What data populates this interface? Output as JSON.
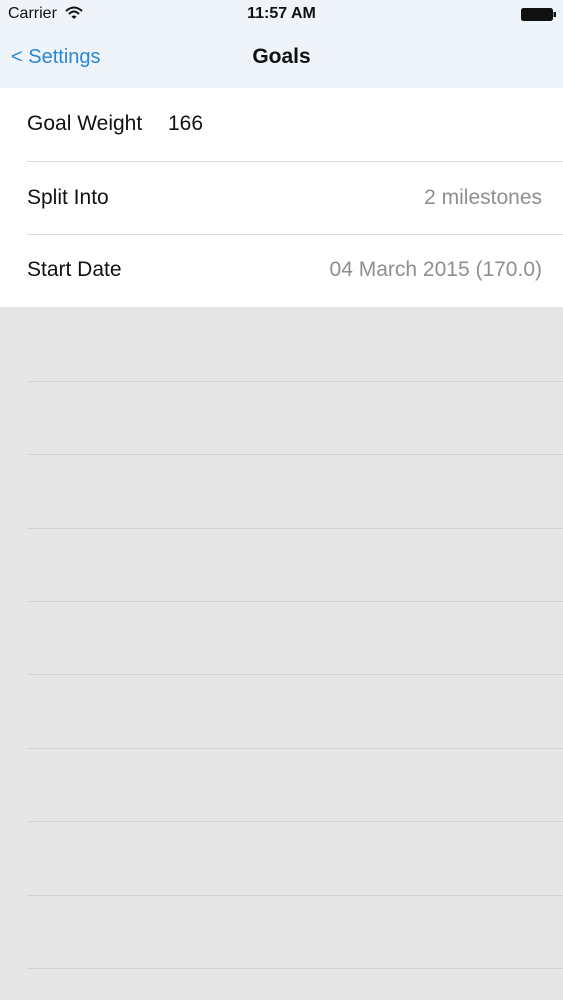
{
  "status_bar": {
    "carrier": "Carrier",
    "time": "11:57 AM",
    "wifi_icon": "wifi-icon",
    "battery_icon": "battery-icon"
  },
  "nav": {
    "back_label": "< Settings",
    "title": "Goals",
    "back_color": "#2a86d8"
  },
  "form": {
    "goal_weight": {
      "label": "Goal Weight",
      "value": "166"
    },
    "split_into": {
      "label": "Split Into",
      "value": "2 milestones"
    },
    "start_date": {
      "label": "Start Date",
      "value": "04 March 2015 (170.0)"
    }
  },
  "colors": {
    "background": "#e6e6e7",
    "nav_background": "#eef4f9",
    "secondary_text": "#8e8e93"
  }
}
